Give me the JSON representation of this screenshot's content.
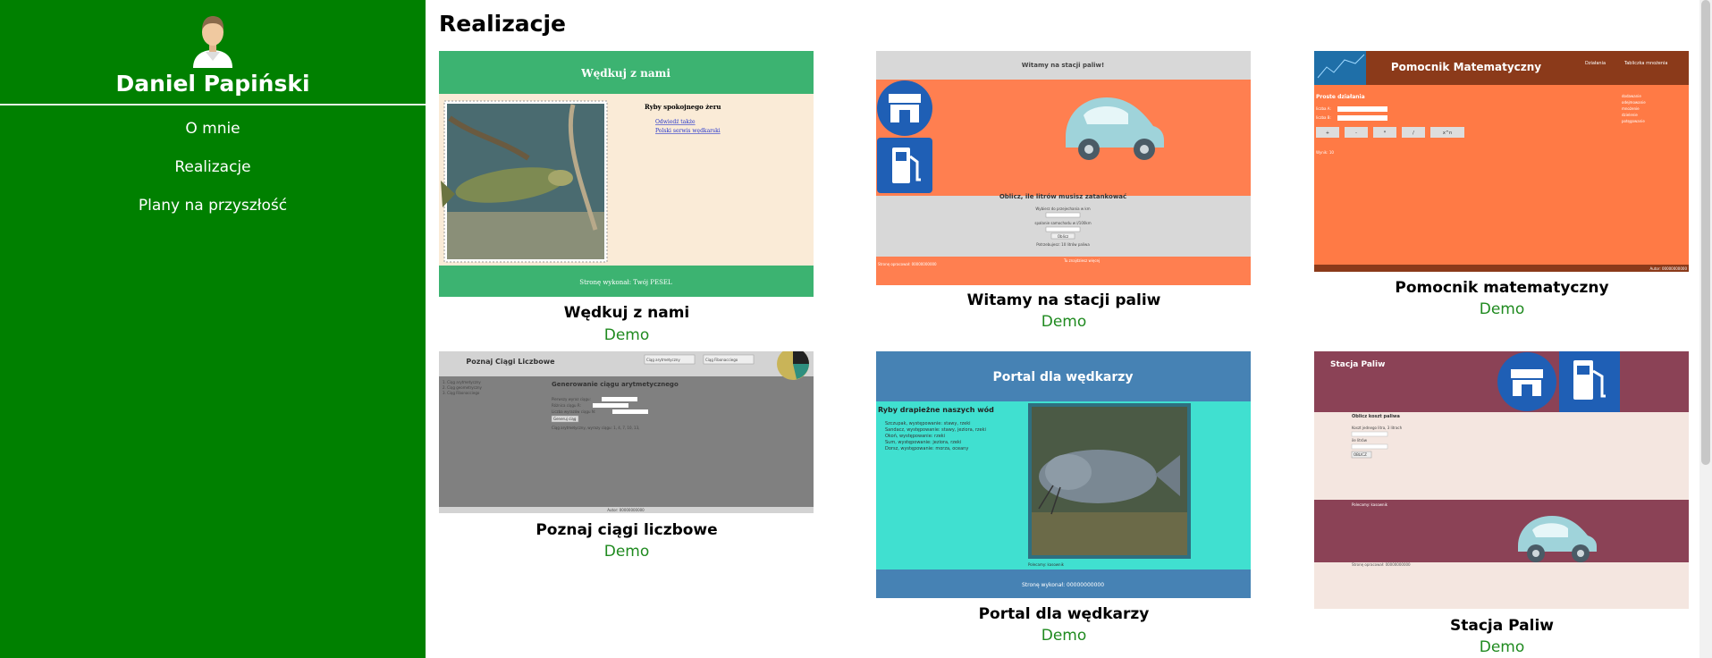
{
  "sidebar": {
    "name": "Daniel Papiński",
    "nav": [
      {
        "label": "O mnie"
      },
      {
        "label": "Realizacje"
      },
      {
        "label": "Plany na przyszłość"
      }
    ]
  },
  "main": {
    "title": "Realizacje",
    "cards": [
      {
        "title": "Wędkuj z nami",
        "demo": "Demo",
        "shot": {
          "header": "Wędkuj z nami",
          "list_heading": "Ryby spokojnego żeru",
          "links": [
            "Odwiedź także",
            "Polski serwis wędkarski"
          ],
          "footer": "Stronę wykonał: Twój PESEL"
        }
      },
      {
        "title": "Witamy na stacji paliw",
        "demo": "Demo",
        "shot": {
          "header": "Witamy na stacji paliw!",
          "calc_title": "Oblicz, ile litrów musisz zatankować",
          "field1": "Wybierz do przejechania w km",
          "field2": "spalanie samochodu w l/100km",
          "button": "Oblicz",
          "result": "Potrzebujesz: 10 litrów paliwa",
          "footer_left": "Stronę opracował: 00000000000",
          "footer_right": "Tu znajdziesz więcej"
        }
      },
      {
        "title": "Pomocnik matematyczny",
        "demo": "Demo",
        "shot": {
          "header": "Pomocnik Matematyczny",
          "nav1": "Działania",
          "nav2": "Tabliczka mnożenia",
          "section": "Proste działania",
          "label_a": "liczba A:",
          "label_b": "liczba B:",
          "buttons": [
            "+",
            "-",
            "*",
            "/",
            "x^n"
          ],
          "result": "Wynik: 10",
          "list": [
            "dodawanie",
            "odejmowanie",
            "mnożenie",
            "dzielenie",
            "potęgowanie"
          ],
          "footer": "Autor: 00000000000"
        }
      },
      {
        "title": "Poznaj ciągi liczbowe",
        "demo": "Demo",
        "shot": {
          "header": "Poznaj Ciągi Liczbowe",
          "tab1": "Ciąg arytmetyczny",
          "tab2": "Ciąg Fibonacciego",
          "menu": [
            "1. Ciąg arytmetyczny",
            "2. Ciąg geometryczny",
            "3. Ciąg Fibonacciego"
          ],
          "section": "Generowanie ciągu arytmetycznego",
          "field1": "Pierwszy wyraz ciągu:",
          "field2": "Różnica ciągu R:",
          "field3": "Liczba wyrazów ciągu N:",
          "button": "Generuj ciąg",
          "result": "Ciąg arytmetyczny, wyrazy ciągu: 1, 4, 7, 10, 13,",
          "footer": "Autor: 00000000000"
        }
      },
      {
        "title": "Portal dla wędkarzy",
        "demo": "Demo",
        "shot": {
          "header": "Portal dla wędkarzy",
          "section": "Ryby drapieżne naszych wód",
          "list": [
            "Szczupak, występowanie: stawy, rzeki",
            "Sandacz, występowanie: stawy, jeziora, rzeki",
            "Okoń, występowanie: rzeki",
            "Sum, występowanie: jeziora, rzeki",
            "Dorsz, występowanie: morza, oceany"
          ],
          "link": "Polecamy: kasownik",
          "footer": "Stronę wykonał: 00000000000"
        }
      },
      {
        "title": "Stacja Paliw",
        "demo": "Demo",
        "shot": {
          "header": "Stacja Paliw",
          "section": "Oblicz koszt paliwa",
          "field1": "Koszt jednego litra, 3 litrach",
          "field2": "ile litrów",
          "button": "OBLICZ",
          "link": "Polecamy: kasownik",
          "footer": "Stronę opracował: 00000000000"
        }
      }
    ]
  },
  "colors": {
    "sidebar": "#008000",
    "demo_link": "#1f8a1f",
    "fish_green": "#3cb371",
    "fish_cream": "#faebd7",
    "fuel_orange": "#ff7f50",
    "math_orange": "#ff7a45",
    "math_brown": "#8b3a1a",
    "seq_gray": "#808080",
    "portal_blue": "#4682b4",
    "portal_cyan": "#40e0d0",
    "station_maroon": "#8b4256",
    "station_beige": "#f4e6e0",
    "icon_blue": "#1f5fb5"
  },
  "icons": [
    "user-avatar",
    "store-icon",
    "fuel-pump-icon",
    "car-icon"
  ]
}
